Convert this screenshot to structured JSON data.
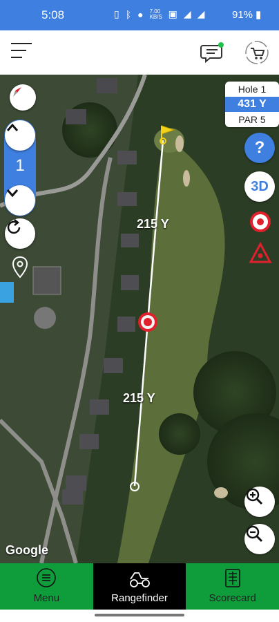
{
  "status_bar": {
    "time": "5:08",
    "battery": "91%",
    "speed": "7.00 KB/S"
  },
  "header": {
    "menu_icon": "hamburger-icon",
    "chat_icon": "chat-icon",
    "cart_icon": "cart-icon"
  },
  "hole_card": {
    "hole": "Hole 1",
    "yardage": "431 Y",
    "par": "PAR 5"
  },
  "hole_selector": {
    "number": "1"
  },
  "map": {
    "distance_top": "215 Y",
    "distance_bottom": "215 Y",
    "attribution": "Google"
  },
  "buttons": {
    "help": "?",
    "three_d": "3D"
  },
  "nav": {
    "menu": "Menu",
    "rangefinder": "Rangefinder",
    "scorecard": "Scorecard",
    "active": "Rangefinder"
  },
  "colors": {
    "accent_blue": "#3f7fe0",
    "nav_green": "#0f9c3a",
    "target_red": "#e0202c",
    "flag_yellow": "#f2d21a"
  }
}
